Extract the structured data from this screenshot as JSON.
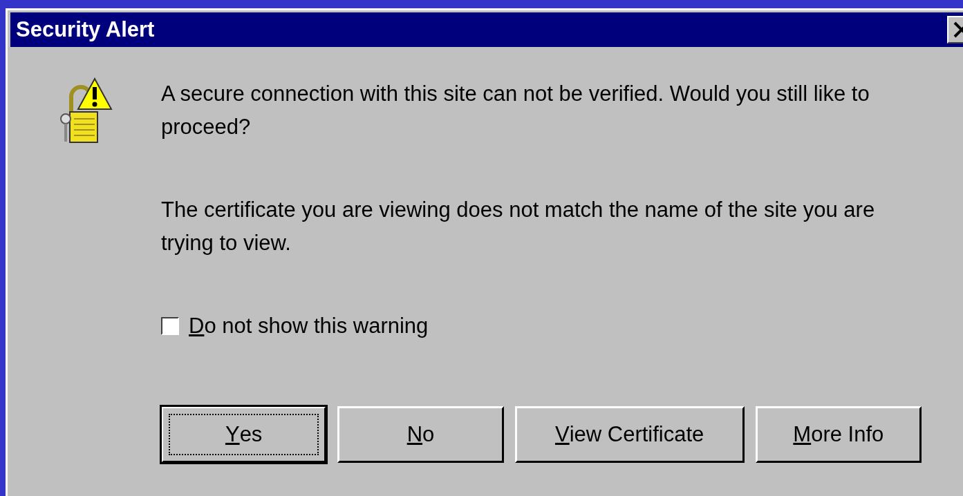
{
  "window": {
    "title": "Security Alert"
  },
  "message": {
    "paragraphs": [
      "A secure connection with this site can not be verified. Would you still like to proceed?",
      "The certificate you are viewing does not match the name of the site you are trying to view."
    ]
  },
  "checkbox": {
    "label": "Do not show this warning",
    "checked": false,
    "underlined_first_letter": true
  },
  "buttons": [
    {
      "label": "Yes",
      "default": true,
      "underlined_first_letter": true
    },
    {
      "label": "No",
      "default": false,
      "underlined_first_letter": true
    },
    {
      "label": "View Certificate",
      "default": false,
      "underlined_first_letter": true
    },
    {
      "label": "More Info",
      "default": false,
      "underlined_first_letter": true
    }
  ]
}
